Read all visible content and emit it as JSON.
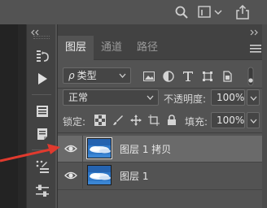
{
  "panel": {
    "tabs": [
      {
        "label": "图层",
        "active": true
      },
      {
        "label": "通道",
        "active": false
      },
      {
        "label": "路径",
        "active": false
      }
    ],
    "filter": {
      "prefix": "ρ",
      "label": "类型"
    },
    "blend_mode": "正常",
    "opacity_label": "不透明度:",
    "opacity_value": "100%",
    "lock_label": "锁定:",
    "fill_label": "填充:",
    "fill_value": "100%"
  },
  "layers": [
    {
      "name": "图层 1 拷贝",
      "visible": true,
      "selected": true
    },
    {
      "name": "图层 1",
      "visible": true,
      "selected": false
    }
  ],
  "colors": {
    "panel_bg": "#535353",
    "panel_header": "#424242",
    "selected_row": "#6a6a6a",
    "annotation_arrow": "#e03a2e",
    "thumb_sky": "#2f78c8"
  },
  "icons": {
    "top": [
      "search-icon",
      "window-arrange-icon",
      "share-icon"
    ],
    "toolstrip": [
      "history-icon",
      "play-action-icon",
      "properties-icon",
      "notes-icon",
      "brush-settings-icon",
      "adjustments-icon"
    ],
    "filters": [
      "image-filter-icon",
      "adjustment-filter-icon",
      "type-filter-icon",
      "shape-filter-icon",
      "smart-object-filter-icon",
      "filter-toggle-icon"
    ],
    "locks": [
      "lock-transparent-pixels-icon",
      "lock-image-pixels-icon",
      "lock-position-icon",
      "lock-artboard-icon",
      "lock-all-icon"
    ]
  }
}
